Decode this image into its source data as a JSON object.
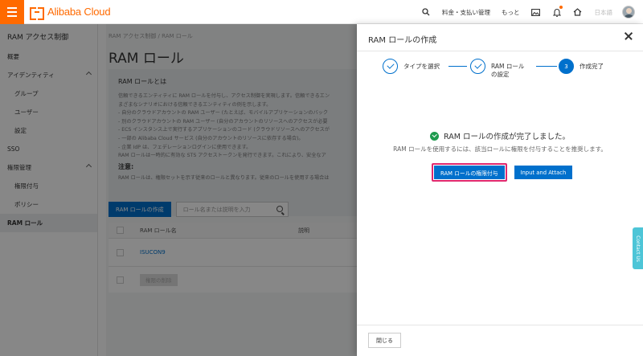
{
  "header": {
    "logo_text": "Alibaba Cloud",
    "billing": "料金・支払い管理",
    "more": "もっと",
    "language": "日本語",
    "accent_color": "#ff6a00"
  },
  "sidebar": {
    "title": "RAM アクセス制御",
    "items": [
      {
        "label": "概要"
      },
      {
        "label": "アイデンティティ"
      },
      {
        "label": "グループ"
      },
      {
        "label": "ユーザー"
      },
      {
        "label": "設定"
      },
      {
        "label": "SSO"
      },
      {
        "label": "権限管理"
      },
      {
        "label": "権限付与"
      },
      {
        "label": "ポリシー"
      },
      {
        "label": "RAM ロール"
      }
    ]
  },
  "main": {
    "breadcrumb_root": "RAM アクセス制御",
    "breadcrumb_sep": "/",
    "breadcrumb_current": "RAM ロール",
    "page_title": "RAM ロール",
    "info_title": "RAM ロールとは",
    "info_lines": [
      "信頼できるエンティティに RAM ロールを付与し、アクセス制御を実現します。信頼できるエン",
      "まざまなシナリオにおける信頼できるエンティティの例を示します。",
      "- 自分のクラウドアカウントの RAM ユーザー (たとえば、モバイルアプリケーションのバック",
      "- 別のクラウドアカウントの RAM ユーザー (自分のアカウントのリソースへのアクセスが必要",
      "- ECS インスタンス上で実行するアプリケーションのコード (クラウドリソースへのアクセスが",
      "- 一部の Alibaba Cloud サービス (自分のアカウントのリソースに依存する場合)。",
      "- 企業 IdP は、フェデレーションログインに使用できます。",
      "RAM ロールは一時的に有効な STS アクセストークンを発行できます。これにより、安全なア"
    ],
    "note_title": "注意:",
    "note_text": "RAM ロールは、権限セットを示す従来のロールと異なります。従来のロールを使用する場合は",
    "create_button": "RAM ロールの作成",
    "search_placeholder": "ロール名または説明を入力",
    "columns": {
      "name": "RAM ロール名",
      "desc": "説明"
    },
    "rows": [
      {
        "name": "ISUCON9"
      }
    ],
    "bulk_delete": "権限の削除"
  },
  "panel": {
    "title": "RAM ロールの作成",
    "steps": [
      {
        "label": "タイプを選択"
      },
      {
        "label_line1": "RAM ロール",
        "label_line2": "の設定"
      },
      {
        "number": "3",
        "label": "作成完了"
      }
    ],
    "success_message": "RAM ロールの作成が完了しました。",
    "hint": "RAM ロールを使用するには、該当ロールに権限を付与することを推奨します。",
    "grant_button": "RAM ロールの権限付与",
    "input_attach_button": "Input and Attach",
    "close_button": "閉じる"
  },
  "contact": {
    "label": "Contact Us"
  }
}
